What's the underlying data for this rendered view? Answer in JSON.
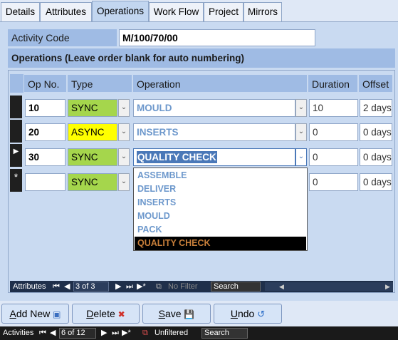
{
  "tabs": [
    "Details",
    "Attributes",
    "Operations",
    "Work Flow",
    "Project",
    "Mirrors"
  ],
  "activity_code": {
    "label": "Activity Code",
    "value": "M/100/70/00"
  },
  "operations_heading": "Operations (Leave order blank for auto numbering)",
  "grid": {
    "headers": {
      "op_no": "Op No.",
      "type": "Type",
      "operation": "Operation",
      "duration": "Duration",
      "offset": "Offset"
    },
    "rows": [
      {
        "op_no": "10",
        "type": "SYNC",
        "operation": "MOULD",
        "duration": "10",
        "offset": "2 days",
        "type_color": "#a5d64c"
      },
      {
        "op_no": "20",
        "type": "ASYNC",
        "operation": "INSERTS",
        "duration": "0",
        "offset": "0 days",
        "type_color": "#ffff00"
      },
      {
        "op_no": "30",
        "type": "SYNC",
        "operation": "QUALITY CHECK",
        "duration": "0",
        "offset": "0 days",
        "type_color": "#a5d64c"
      },
      {
        "op_no": "",
        "type": "SYNC",
        "operation": "",
        "duration": "0",
        "offset": "0 days",
        "type_color": "#a5d64c"
      }
    ],
    "current_marker": "▶",
    "new_marker": "*"
  },
  "dropdown": {
    "options": [
      "ASSEMBLE",
      "DELIVER",
      "INSERTS",
      "MOULD",
      "PACK",
      "QUALITY CHECK"
    ],
    "selected": "QUALITY CHECK"
  },
  "subform_nav": {
    "label": "Attributes",
    "record": "3 of 3",
    "filter": "No Filter",
    "search": "Search"
  },
  "buttons": {
    "add_new": {
      "accel": "A",
      "rest": "dd New"
    },
    "delete": {
      "accel": "D",
      "rest": "elete"
    },
    "save": {
      "accel": "S",
      "rest": "ave"
    },
    "undo": {
      "accel": "U",
      "rest": "ndo"
    }
  },
  "main_nav": {
    "label": "Activities",
    "record": "6 of 12",
    "filter": "Unfiltered",
    "search": "Search"
  },
  "colors": {
    "accent_blue": "#6d98cc",
    "panel": "#c9daf1",
    "header": "#9fbbe4"
  }
}
